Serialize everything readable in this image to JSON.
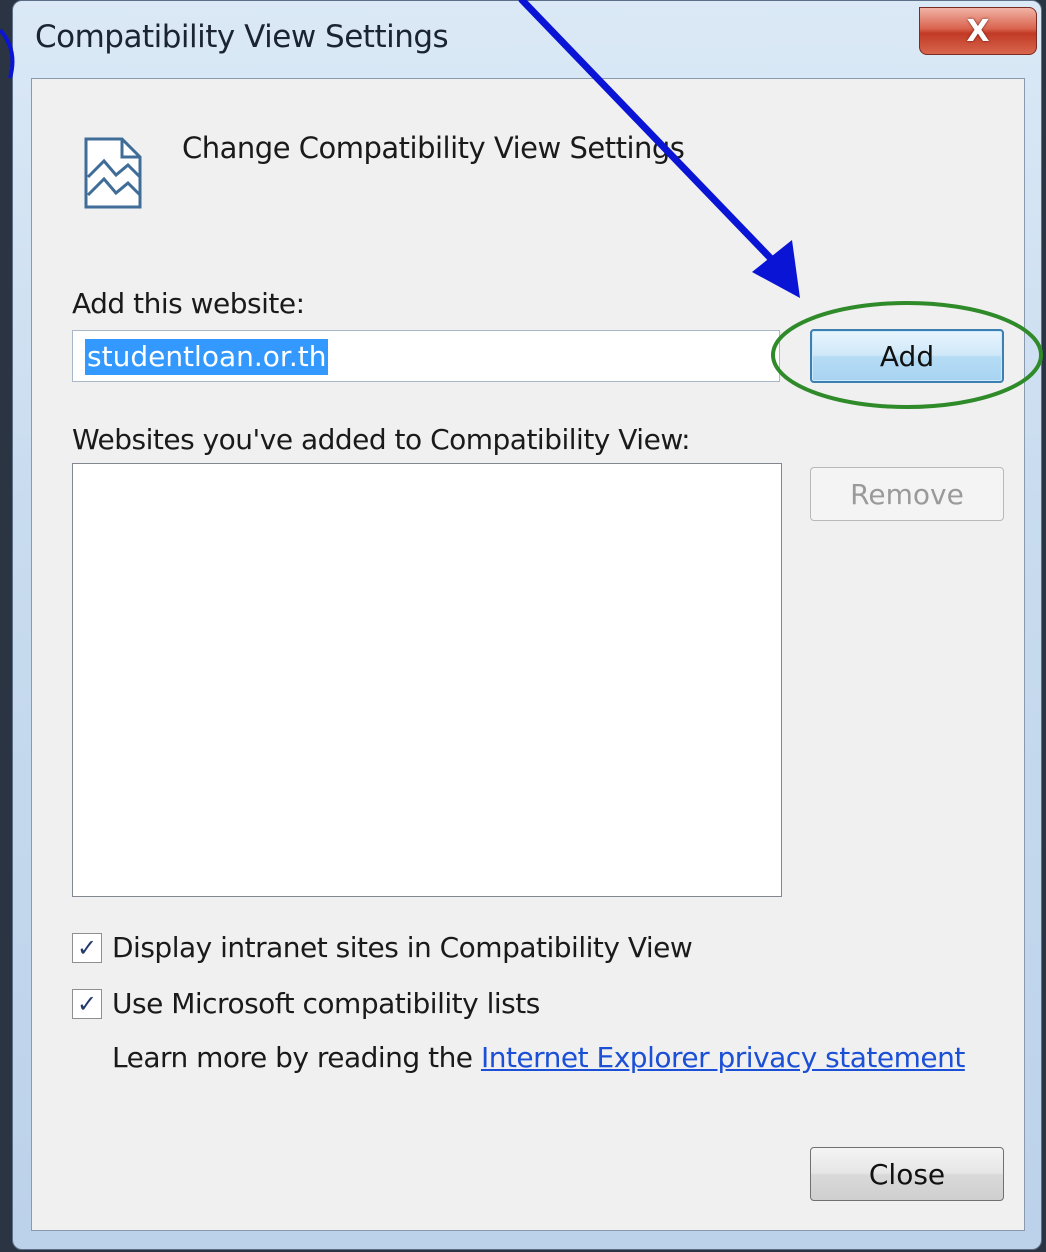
{
  "window": {
    "title": "Compatibility View Settings",
    "close_glyph": "X"
  },
  "header": {
    "icon": "compatibility-page-icon",
    "title": "Change Compatibility View Settings"
  },
  "add_section": {
    "label": "Add this website:",
    "input_value": "studentloan.or.th",
    "add_button": "Add"
  },
  "list_section": {
    "label": "Websites you've added to Compatibility View:",
    "items": [],
    "remove_button": "Remove"
  },
  "options": {
    "intranet": {
      "label": "Display intranet sites in Compatibility View",
      "checked": true
    },
    "ms_lists": {
      "label": "Use Microsoft compatibility lists",
      "checked": true
    },
    "privacy_prefix": "Learn more by reading the",
    "privacy_link": "Internet Explorer privacy statement"
  },
  "footer": {
    "close_button": "Close"
  },
  "annotations": {
    "arrow_color": "#0a14d4",
    "highlight_ring_color": "#2f8a2a"
  },
  "colors": {
    "selection": "#3399ff",
    "link": "#1a4fd6"
  }
}
